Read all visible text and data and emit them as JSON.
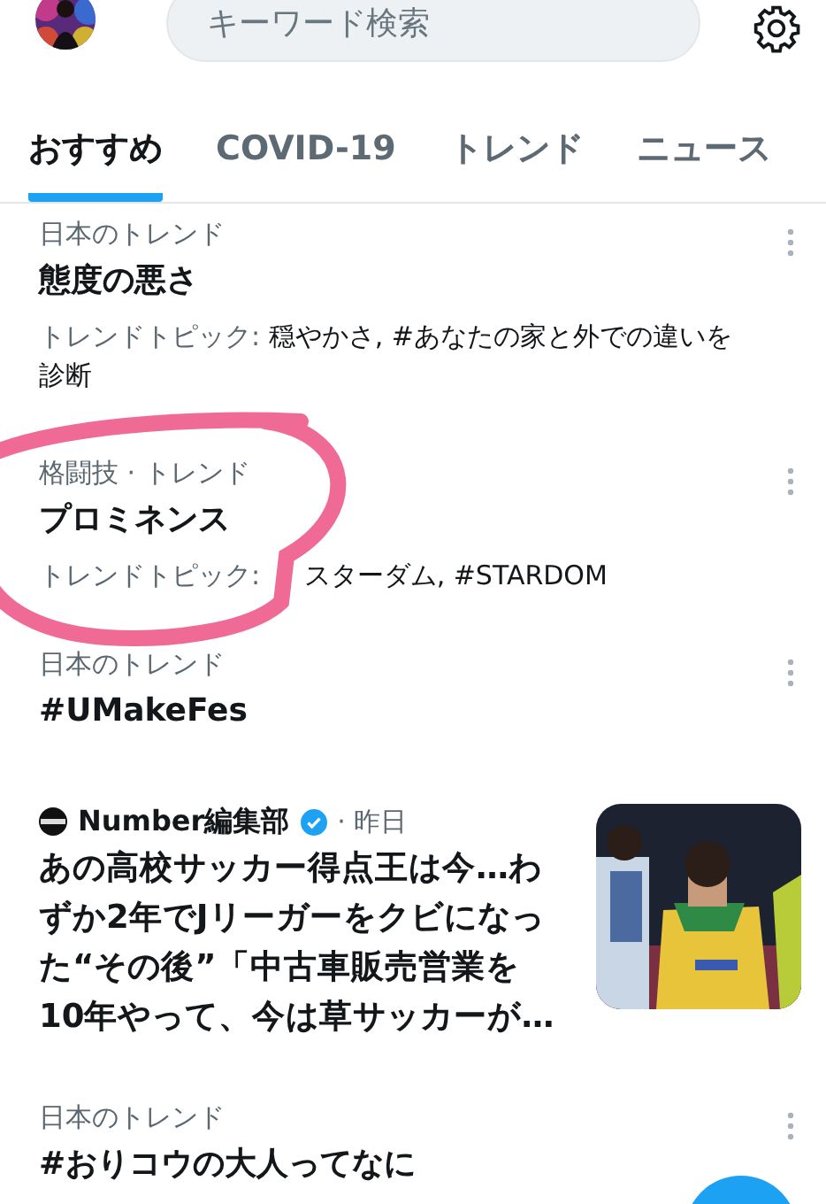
{
  "search": {
    "placeholder": "キーワード検索"
  },
  "tabs": [
    {
      "label": "おすすめ",
      "selected": true
    },
    {
      "label": "COVID-19",
      "selected": false
    },
    {
      "label": "トレンド",
      "selected": false
    },
    {
      "label": "ニュース",
      "selected": false
    }
  ],
  "feed": [
    {
      "kind": "trend",
      "category": "日本のトレンド",
      "title": "態度の悪さ",
      "topics": "トレンドトピック: ",
      "topics_items": "穏やかさ, #あなたの家と外での違いを診断"
    },
    {
      "kind": "trend",
      "category": "格闘技 · トレンド",
      "title": "プロミネンス",
      "topics": "トレンドトピック: ",
      "topics_items": "スターダム, #STARDOM"
    },
    {
      "kind": "trend",
      "category": "日本のトレンド",
      "title": "#UMakeFes"
    },
    {
      "kind": "news",
      "author": "Number編集部",
      "time": "· 昨日",
      "headline": "あの高校サッカー得点王は今…わずか2年でJリーガーをクビになった“その後”「中古車販売営業を10年やって、今は草サッカーが…"
    },
    {
      "kind": "trend",
      "category": "日本のトレンド",
      "title": "#おりコウの大人ってなに"
    }
  ]
}
